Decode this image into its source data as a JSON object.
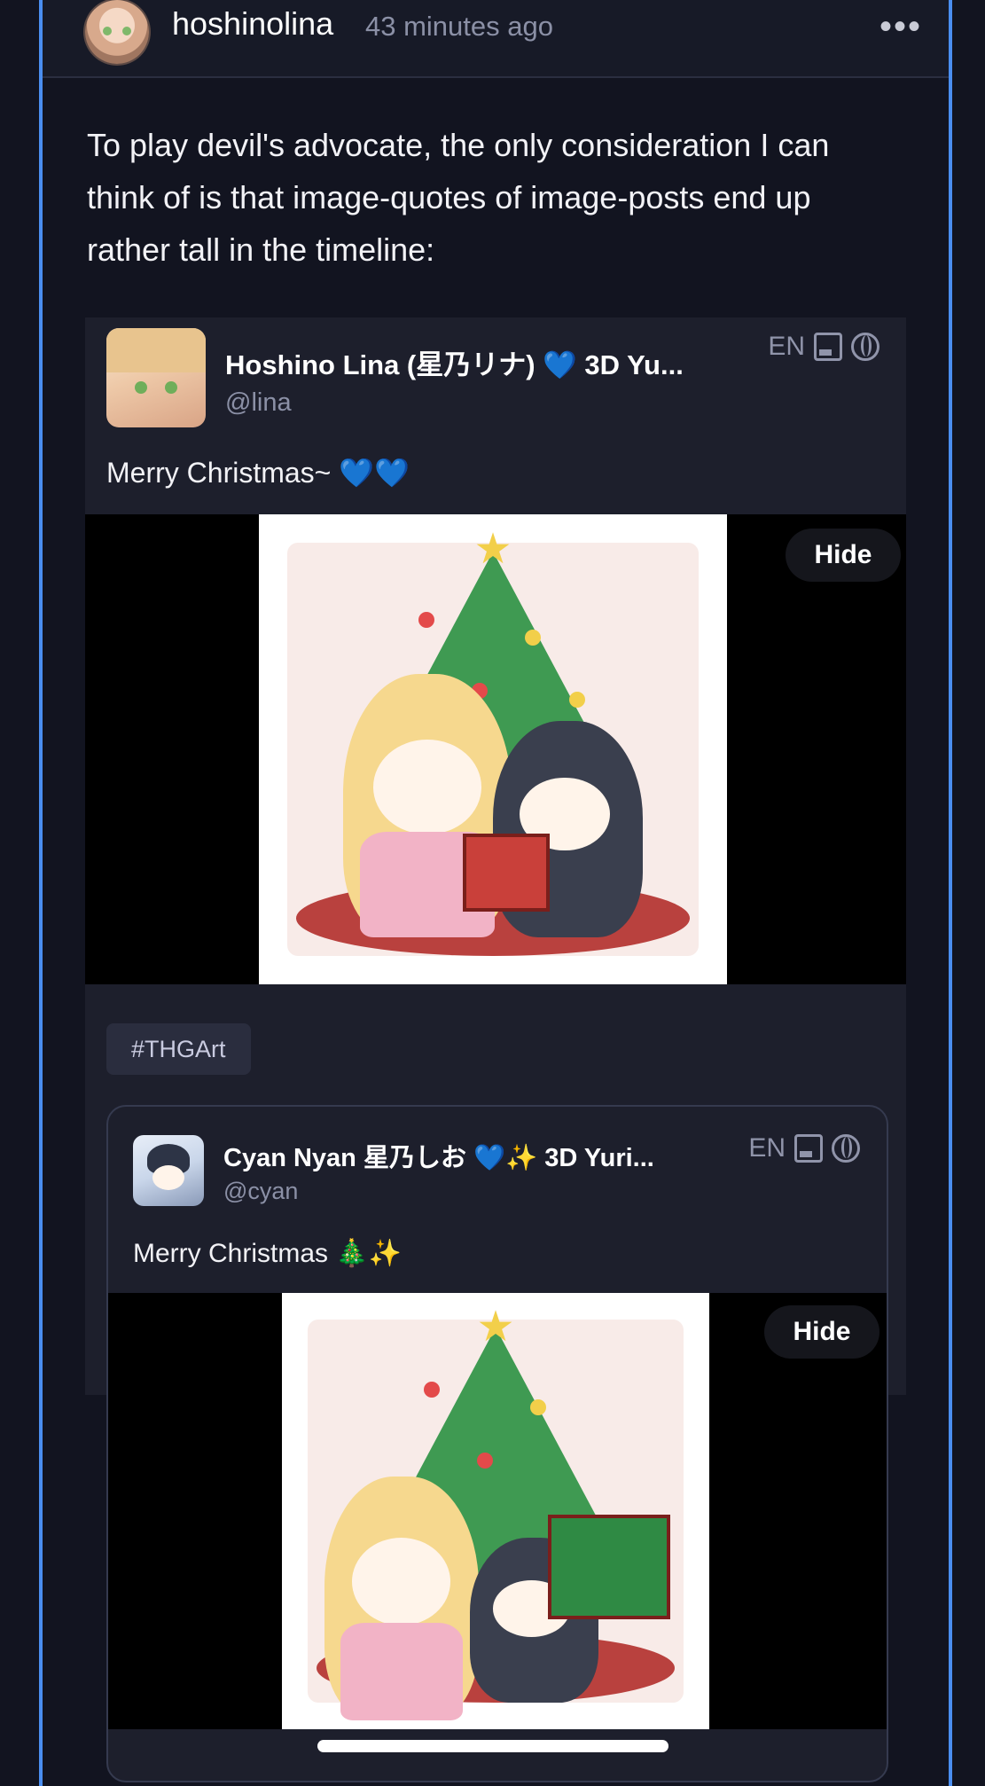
{
  "post": {
    "username": "hoshinolina",
    "time": "43 minutes ago",
    "more_label": "•••",
    "body": "To play devil's advocate, the only consideration I can think of is that image-quotes of image-posts end up rather tall in the timeline:"
  },
  "quote1": {
    "display_name": "Hoshino Lina (星乃リナ) 💙 3D Yu...",
    "handle": "@lina",
    "lang": "EN",
    "text": "Merry Christmas~ 💙💙",
    "hide_label": "Hide",
    "hashtag": "#THGArt"
  },
  "quote2": {
    "display_name": "Cyan Nyan 星乃しお 💙✨ 3D Yuri...",
    "handle": "@cyan",
    "lang": "EN",
    "text": "Merry Christmas 🎄✨",
    "hide_label": "Hide"
  },
  "icons": {
    "more": "ellipsis-icon",
    "image": "image-icon",
    "globe": "globe-icon"
  },
  "colors": {
    "background": "#121420",
    "accent_border": "#4a8ef0",
    "card": "#1d1f2c",
    "muted_text": "#8b90a6"
  }
}
